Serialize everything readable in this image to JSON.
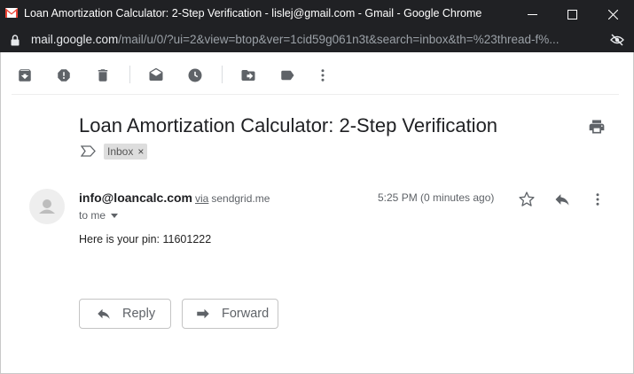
{
  "window": {
    "title": "Loan Amortization Calculator: 2-Step Verification - lislej@gmail.com - Gmail - Google Chrome",
    "app_icon": "gmail-logo"
  },
  "address_bar": {
    "host": "mail.google.com",
    "path": "/mail/u/0/?ui=2&view=btop&ver=1cid59g061n3t&search=inbox&th=%23thread-f%..."
  },
  "toolbar": {
    "icons": [
      "archive-icon",
      "report-spam-icon",
      "delete-icon",
      "mark-unread-icon",
      "snooze-icon",
      "move-to-icon",
      "label-icon",
      "more-vert-icon"
    ]
  },
  "thread": {
    "subject": "Loan Amortization Calculator: 2-Step Verification",
    "label": "Inbox",
    "label_remove": "×"
  },
  "message": {
    "sender": "info@loancalc.com",
    "via": "via",
    "via_domain": "sendgrid.me",
    "recipient": "to me",
    "time": "5:25 PM (0 minutes ago)",
    "body": "Here is your pin: 11601222"
  },
  "actions": {
    "reply_label": "Reply",
    "forward_label": "Forward"
  },
  "colors": {
    "chrome_dark": "#202124",
    "icon_gray": "#5f6368",
    "gmail_red": "#EA4335"
  }
}
